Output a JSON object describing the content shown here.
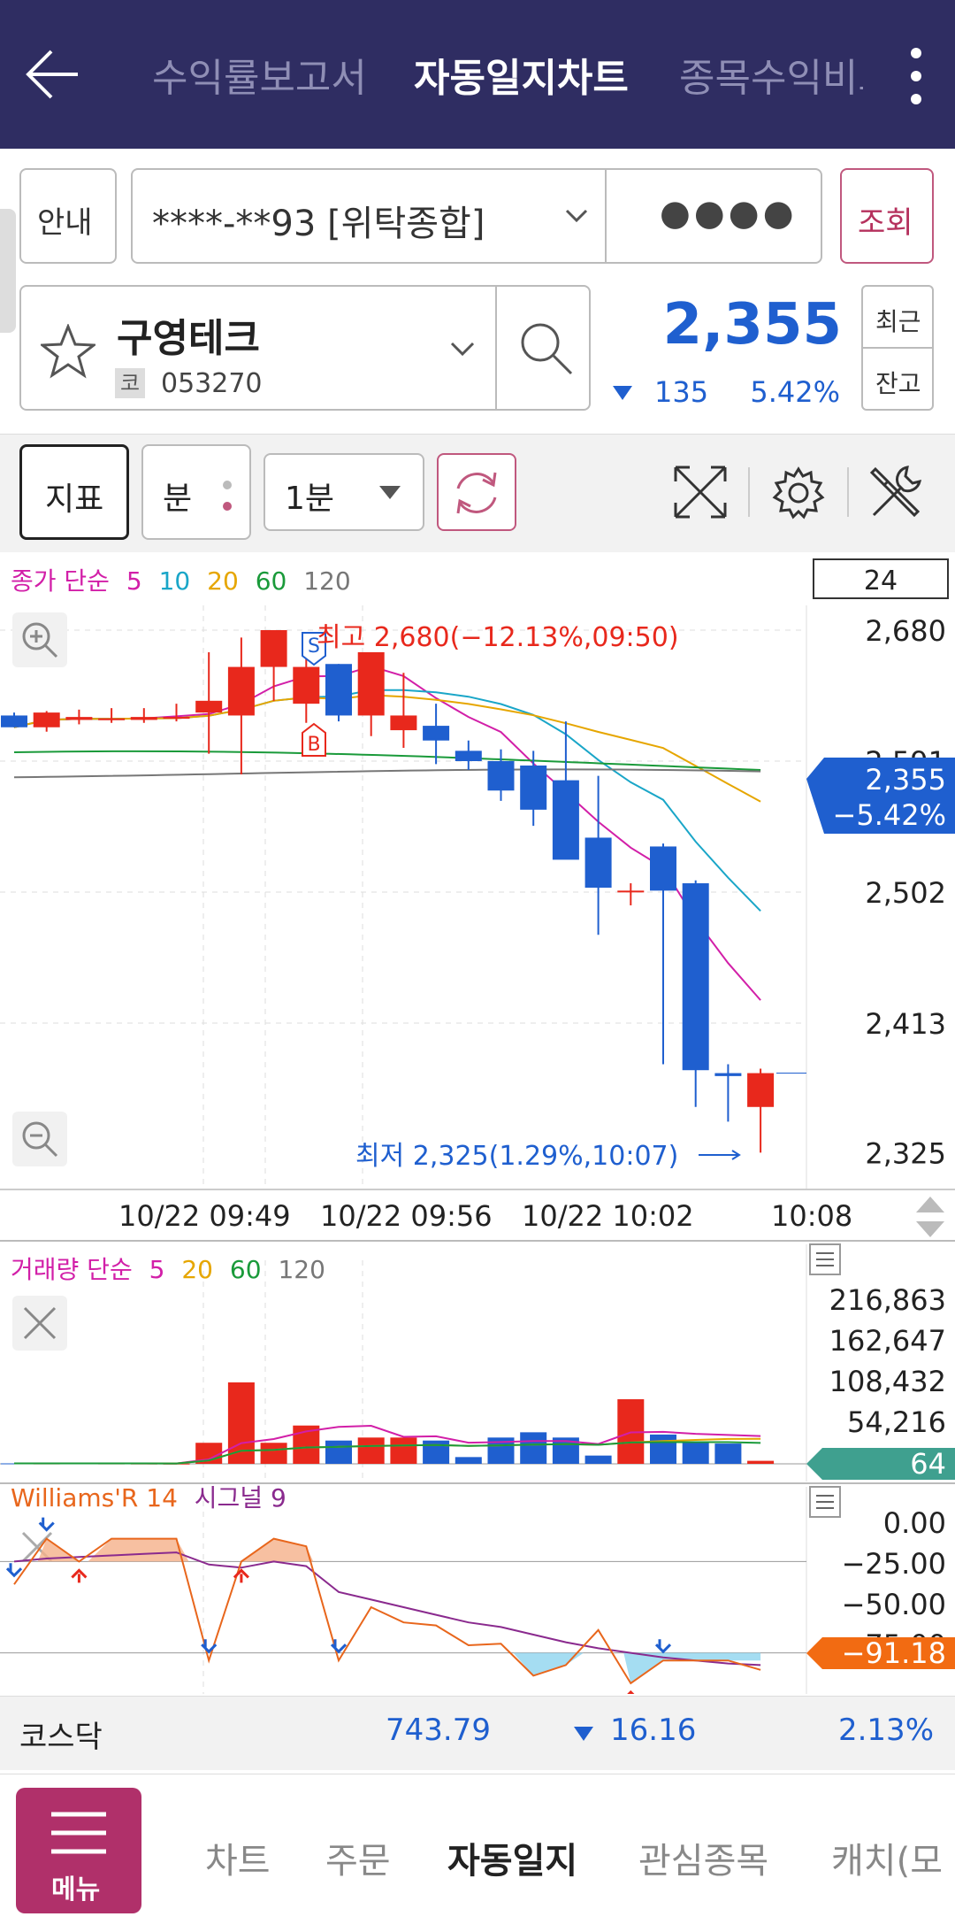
{
  "header": {
    "tabs": [
      {
        "label": "수익률보고서"
      },
      {
        "label": "자동일지차트"
      },
      {
        "label": "종목수익비교"
      }
    ]
  },
  "account": {
    "guide_label": "안내",
    "number": "****-**93 [위탁종합]",
    "password_mask": "●●●●",
    "query_label": "조회"
  },
  "stock": {
    "name": "구영테크",
    "market_badge": "코",
    "code": "053270",
    "price": "2,355",
    "change": "135",
    "change_pct": "5.42%",
    "recent_label": "최근",
    "balance_label": "잔고"
  },
  "toolbar": {
    "indicator_label": "지표",
    "unit_label": "분",
    "interval": "1분"
  },
  "main_chart": {
    "legend": {
      "label": "종가 단순",
      "ma5": "5",
      "ma10": "10",
      "ma20": "20",
      "ma60": "60",
      "ma120": "120"
    },
    "count_box": "24",
    "high_label": "최고 2,680(−12.13%,09:50)",
    "low_label": "최저 2,325(1.29%,10:07)",
    "y_ticks": [
      "2,680",
      "2,591",
      "2,502",
      "2,413",
      "2,325"
    ],
    "current_price": "2,355",
    "current_pct": "−5.42%",
    "time_labels": [
      "10/22 09:49",
      "10/22 09:56",
      "10/22 10:02",
      "10:08"
    ],
    "sell_marker": "S",
    "buy_marker": "B",
    "colors": {
      "up": "#e8281c",
      "down": "#1f5fcf",
      "ma5": "#d21fa8",
      "ma10": "#1aa6c8",
      "ma20": "#e6a600",
      "ma60": "#1a9a3a",
      "ma120": "#777777"
    }
  },
  "chart_data": [
    {
      "type": "candlestick",
      "title": "종가 단순 5 10 20 60 120",
      "y_ticks": [
        2680,
        2591,
        2502,
        2413,
        2325
      ],
      "ylim": [
        2310,
        2705
      ],
      "high": {
        "value": 2680,
        "time": "09:50"
      },
      "low": {
        "value": 2325,
        "time": "10:07"
      },
      "candles": [
        {
          "o": 2622,
          "h": 2624,
          "l": 2614,
          "c": 2614
        },
        {
          "o": 2614,
          "h": 2625,
          "l": 2611,
          "c": 2624
        },
        {
          "o": 2619,
          "h": 2626,
          "l": 2616,
          "c": 2621
        },
        {
          "o": 2619,
          "h": 2627,
          "l": 2617,
          "c": 2620
        },
        {
          "o": 2619,
          "h": 2627,
          "l": 2617,
          "c": 2621
        },
        {
          "o": 2620,
          "h": 2630,
          "l": 2618,
          "c": 2621
        },
        {
          "o": 2624,
          "h": 2665,
          "l": 2596,
          "c": 2632
        },
        {
          "o": 2622,
          "h": 2675,
          "l": 2582,
          "c": 2655
        },
        {
          "o": 2655,
          "h": 2680,
          "l": 2632,
          "c": 2680
        },
        {
          "o": 2630,
          "h": 2675,
          "l": 2617,
          "c": 2655
        },
        {
          "o": 2657,
          "h": 2657,
          "l": 2618,
          "c": 2622
        },
        {
          "o": 2622,
          "h": 2658,
          "l": 2608,
          "c": 2665
        },
        {
          "o": 2612,
          "h": 2651,
          "l": 2600,
          "c": 2622
        },
        {
          "o": 2615,
          "h": 2630,
          "l": 2589,
          "c": 2605
        },
        {
          "o": 2598,
          "h": 2605,
          "l": 2585,
          "c": 2591
        },
        {
          "o": 2591,
          "h": 2599,
          "l": 2564,
          "c": 2571
        },
        {
          "o": 2588,
          "h": 2598,
          "l": 2547,
          "c": 2558
        },
        {
          "o": 2578,
          "h": 2618,
          "l": 2543,
          "c": 2524
        },
        {
          "o": 2539,
          "h": 2581,
          "l": 2473,
          "c": 2505
        },
        {
          "o": 2503,
          "h": 2508,
          "l": 2493,
          "c": 2503
        },
        {
          "o": 2533,
          "h": 2535,
          "l": 2385,
          "c": 2503
        },
        {
          "o": 2508,
          "h": 2510,
          "l": 2356,
          "c": 2381
        },
        {
          "o": 2379,
          "h": 2385,
          "l": 2346,
          "c": 2377
        },
        {
          "o": 2356,
          "h": 2382,
          "l": 2325,
          "c": 2379
        }
      ]
    },
    {
      "type": "bar",
      "title": "거래량 단순 5 20 60 120",
      "y_ticks": [
        216863,
        162647,
        108432,
        54216
      ],
      "current": 64,
      "values": [
        600,
        500,
        700,
        500,
        400,
        300,
        28000,
        108432,
        28000,
        51000,
        31000,
        35000,
        35000,
        31000,
        9000,
        35000,
        42000,
        35000,
        11000,
        86000,
        39000,
        29000,
        27000,
        4000
      ]
    },
    {
      "type": "line",
      "title": "Williams'R 14 시그널 9",
      "y_ticks": [
        0.0,
        -25.0,
        -50.0,
        -75.0
      ],
      "current": -91.18,
      "series": [
        {
          "name": "Williams'R 14",
          "values": [
            -35,
            -5,
            -20,
            -5,
            -5,
            -5,
            -85,
            -20,
            -5,
            -10,
            -85,
            -50,
            -60,
            -62,
            -75,
            -74,
            -95,
            -88,
            -65,
            -100,
            -85,
            -85,
            -85,
            -91.18
          ]
        },
        {
          "name": "시그널 9",
          "values": [
            -20,
            -18,
            -17,
            -16,
            -15,
            -14,
            -22,
            -24,
            -20,
            -23,
            -40,
            -45,
            -50,
            -55,
            -60,
            -63,
            -68,
            -73,
            -77,
            -80,
            -83,
            -85,
            -87,
            -88
          ]
        }
      ]
    }
  ],
  "volume_chart": {
    "legend": {
      "label": "거래량 단순",
      "ma5": "5",
      "ma20": "20",
      "ma60": "60",
      "ma120": "120"
    },
    "y_ticks": [
      "216,863",
      "162,647",
      "108,432",
      "54,216"
    ],
    "current": "64"
  },
  "wr_chart": {
    "legend": {
      "label": "Williams'R 14",
      "signal": "시그널 9"
    },
    "y_ticks": [
      "0.00",
      "−25.00",
      "−50.00",
      "−75.00"
    ],
    "current": "−91.18"
  },
  "market": {
    "name": "코스닥",
    "value": "743.79",
    "change": "16.16",
    "pct": "2.13%"
  },
  "bottom_nav": {
    "menu_label": "메뉴",
    "items": [
      {
        "label": "차트"
      },
      {
        "label": "주문"
      },
      {
        "label": "자동일지"
      },
      {
        "label": "관심종목"
      },
      {
        "label": "캐치(모"
      }
    ]
  }
}
